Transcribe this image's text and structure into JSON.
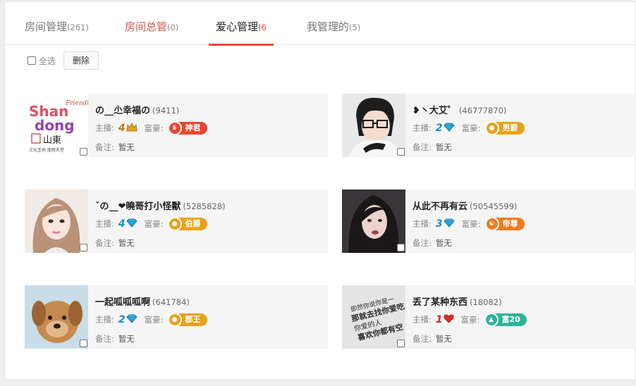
{
  "tabs": [
    {
      "label": "房间管理",
      "count": "(261)",
      "style": "normal"
    },
    {
      "label": "房间总管",
      "count": "(0)",
      "style": "red"
    },
    {
      "label": "爱心管理",
      "count": "(6",
      "style": "active"
    },
    {
      "label": "我管理的",
      "count": "(5)",
      "style": "normal"
    }
  ],
  "toolbar": {
    "select_all_label": "全选",
    "delete_label": "删除"
  },
  "labels": {
    "anchor": "主播:",
    "rich": "富豪:",
    "note": "备注:"
  },
  "users": [
    {
      "nickname": "の__尐幸福の",
      "uid": "(9411)",
      "anchor_level": "4",
      "anchor_icon": "crown-icon",
      "badge": "神君",
      "badge_color": "#e8452f",
      "note": "暂无"
    },
    {
      "nickname": "❥丶大艾゜",
      "uid": "(46777870)",
      "anchor_level": "2",
      "anchor_icon": "diamond-icon",
      "badge": "男爵",
      "badge_color": "#e7a21b",
      "note": "暂无"
    },
    {
      "nickname": "ˇの__❤曉哥打小怪獸",
      "uid": "(5285828)",
      "anchor_level": "4",
      "anchor_icon": "diamond-icon",
      "badge": "伯爵",
      "badge_color": "#e7a21b",
      "note": "暂无"
    },
    {
      "nickname": "从此不再有云",
      "uid": "(50545599)",
      "anchor_level": "3",
      "anchor_icon": "diamond-icon",
      "badge": "帝尊",
      "badge_color": "#ef7a1f",
      "note": "暂无"
    },
    {
      "nickname": "一起呱呱呱啊",
      "uid": "(641784)",
      "anchor_level": "2",
      "anchor_icon": "diamond-icon",
      "badge": "郡王",
      "badge_color": "#e7a21b",
      "note": "暂无"
    },
    {
      "nickname": "丢了某种东西",
      "uid": "(18082)",
      "anchor_level": "1",
      "anchor_icon": "heart-icon",
      "badge": "富20",
      "badge_color": "#2fb39a",
      "note": "暂无"
    }
  ],
  "avatar_images": {
    "logo_text_main": "Shan dong",
    "logo_text_small": "Friendly",
    "logo_cn": "山東",
    "logo_slogan": "文化圣地  度假天堂"
  },
  "colors": {
    "accent": "#e8493b",
    "card_bg": "#f5f5f5"
  }
}
